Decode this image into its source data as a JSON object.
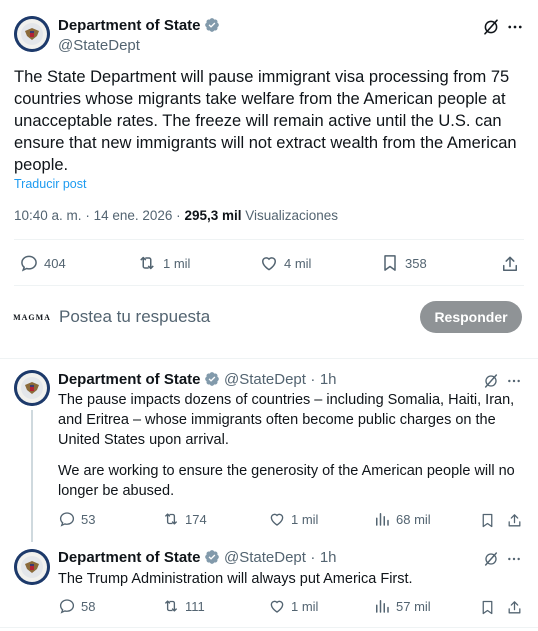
{
  "main_post": {
    "author_name": "Department of State",
    "author_handle": "@StateDept",
    "text": "The State Department will pause immigrant visa processing from 75 countries whose migrants take welfare from the American people at unacceptable rates. The freeze will remain active until the U.S. can ensure that new immigrants will not extract wealth from the American people.",
    "translate_label": "Traducir post",
    "time": "10:40 a. m.",
    "separator": "·",
    "date": "14 ene. 2026",
    "views_count": "295,3 mil",
    "views_label": "Visualizaciones",
    "actions": {
      "replies": "404",
      "reposts": "1 mil",
      "likes": "4 mil",
      "bookmarks": "358"
    }
  },
  "composer": {
    "avatar_text": "MAGMA",
    "placeholder": "Postea tu respuesta",
    "reply_button": "Responder"
  },
  "replies": [
    {
      "author_name": "Department of State",
      "author_handle": "@StateDept",
      "dot": "·",
      "time": "1h",
      "text_p1": "The pause impacts dozens of countries – including Somalia, Haiti, Iran, and Eritrea – whose immigrants often become public charges on the United States upon arrival.",
      "text_p2": "We are working to ensure the generosity of the American people will no longer be abused.",
      "actions": {
        "replies": "53",
        "reposts": "174",
        "likes": "1 mil",
        "views": "68 mil"
      }
    },
    {
      "author_name": "Department of State",
      "author_handle": "@StateDept",
      "dot": "·",
      "time": "1h",
      "text_p1": "The Trump Administration will always put America First.",
      "actions": {
        "replies": "58",
        "reposts": "111",
        "likes": "1 mil",
        "views": "57 mil"
      }
    }
  ],
  "colors": {
    "accent": "#1d9bf0",
    "verified": "#829aab",
    "text": "#0f1419",
    "secondary": "#536471",
    "reply_button": "#8f9396"
  }
}
